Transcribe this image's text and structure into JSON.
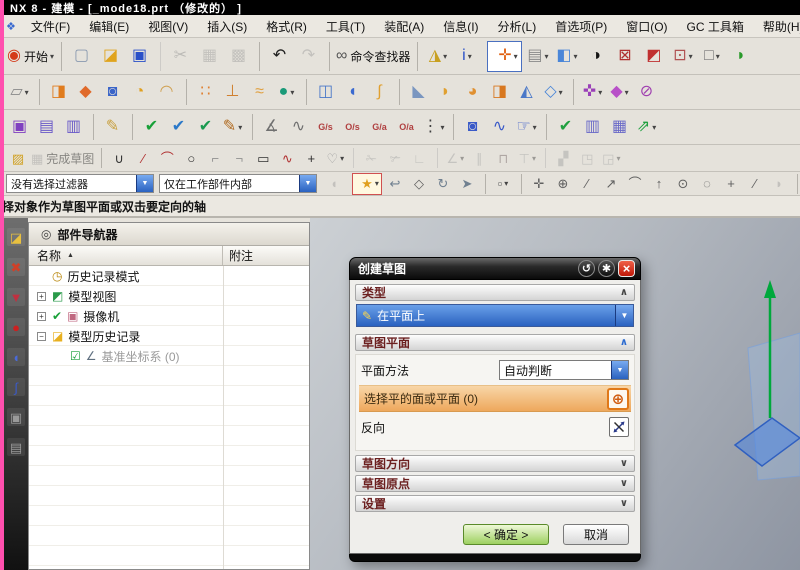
{
  "app": {
    "title": "NX 8 - 建模 - [_mode18.prt （修改的） ]"
  },
  "menu": {
    "window_icon": "❖",
    "items": [
      {
        "n": "menu-file",
        "label": "文件(F)"
      },
      {
        "n": "menu-edit",
        "label": "编辑(E)"
      },
      {
        "n": "menu-view",
        "label": "视图(V)"
      },
      {
        "n": "menu-insert",
        "label": "插入(S)"
      },
      {
        "n": "menu-format",
        "label": "格式(R)"
      },
      {
        "n": "menu-tools",
        "label": "工具(T)"
      },
      {
        "n": "menu-assemblies",
        "label": "装配(A)"
      },
      {
        "n": "menu-information",
        "label": "信息(I)"
      },
      {
        "n": "menu-analysis",
        "label": "分析(L)"
      },
      {
        "n": "menu-preferences",
        "label": "首选项(P)"
      },
      {
        "n": "menu-window",
        "label": "窗口(O)"
      },
      {
        "n": "menu-gc-toolbox",
        "label": "GC 工具箱"
      },
      {
        "n": "menu-help",
        "label": "帮助(H)"
      }
    ]
  },
  "toolbars": {
    "row_a": [
      {
        "n": "start-button",
        "g": "◉",
        "c": "#d43a1a",
        "label": "开始",
        "dd": 1
      },
      {
        "n": "new-file-button",
        "g": "▢",
        "c": "#8a9ab0",
        "sep": 1
      },
      {
        "n": "open-file-button",
        "g": "◪",
        "c": "#e0a41e"
      },
      {
        "n": "save-button",
        "g": "▣",
        "c": "#2a50c8"
      },
      {
        "n": "cut-button",
        "g": "✂",
        "c": "#8a8a8a",
        "d": 1,
        "sep": 1
      },
      {
        "n": "copy-button",
        "g": "▦",
        "c": "#9a9a9a",
        "d": 1
      },
      {
        "n": "paste-button",
        "g": "▩",
        "c": "#9a9a9a",
        "d": 1
      },
      {
        "n": "undo-button",
        "g": "↶",
        "c": "#202020",
        "sep": 1
      },
      {
        "n": "redo-button",
        "g": "↷",
        "c": "#9a9a9a",
        "d": 1
      },
      {
        "n": "command-finder-button",
        "g": "∞",
        "c": "#555555",
        "label": "命令查找器",
        "sep": 1
      },
      {
        "n": "sketch-in-task-button",
        "g": "◮",
        "c": "#c8a020",
        "dd": 1,
        "sep": 1
      },
      {
        "n": "info-button",
        "g": "i",
        "c": "#2a50c8",
        "dd": 1
      },
      {
        "n": "fit-view-button",
        "g": "✛",
        "c": "#e06010",
        "dd": 1,
        "sep": 1,
        "b": "#4a70c0",
        "bg": "#ffffff"
      },
      {
        "n": "layout-button",
        "g": "▤",
        "c": "#8a8a8a",
        "dd": 1
      },
      {
        "n": "shaded-view-button",
        "g": "◧",
        "c": "#4a86d8",
        "dd": 1
      },
      {
        "n": "render-style-button",
        "g": "◑",
        "c": "#141414"
      },
      {
        "n": "clip-section-button",
        "g": "⊠",
        "c": "#b03030"
      },
      {
        "n": "section-view-button",
        "g": "◩",
        "c": "#c03030"
      },
      {
        "n": "edit-section-button",
        "g": "⊡",
        "c": "#b05050",
        "dd": 1
      },
      {
        "n": "background-button",
        "g": "□",
        "c": "#787878",
        "dd": 1
      },
      {
        "n": "edge-display-button",
        "g": "◗",
        "c": "#2a9a2a"
      }
    ],
    "row_b": [
      {
        "n": "datum-plane-button",
        "g": "▱",
        "c": "#8a8a8a",
        "dd": 1
      },
      {
        "n": "extrude-button",
        "g": "◨",
        "c": "#e07c1e",
        "sep": 1
      },
      {
        "n": "revolve-button",
        "g": "◆",
        "c": "#e06a2a"
      },
      {
        "n": "hole-button",
        "g": "◙",
        "c": "#3a64c8"
      },
      {
        "n": "boss-button",
        "g": "◔",
        "c": "#e0a020"
      },
      {
        "n": "pocket-button",
        "g": "◠",
        "c": "#d0a050"
      },
      {
        "n": "pattern-feature-button",
        "g": "∷",
        "c": "#e08030",
        "sep": 1
      },
      {
        "n": "draft-button",
        "g": "⊥",
        "c": "#d08030"
      },
      {
        "n": "chain-feature-button",
        "g": "≈",
        "c": "#e0a040"
      },
      {
        "n": "unite-button",
        "g": "●",
        "c": "#1a9a78",
        "dd": 1
      },
      {
        "n": "trim-body-button",
        "g": "◫",
        "c": "#4a78c8",
        "sep": 1
      },
      {
        "n": "split-body-button",
        "g": "◖",
        "c": "#3a6ad0"
      },
      {
        "n": "bend-button",
        "g": "∫",
        "c": "#e0a030"
      },
      {
        "n": "chamfer-button",
        "g": "◣",
        "c": "#7a96c0",
        "sep": 1
      },
      {
        "n": "edge-blend-button",
        "g": "◗",
        "c": "#e0a030"
      },
      {
        "n": "face-blend-button",
        "g": "◕",
        "c": "#e09030"
      },
      {
        "n": "box-feature-button",
        "g": "◨",
        "c": "#d87820"
      },
      {
        "n": "taper-button",
        "g": "◭",
        "c": "#4a78c8"
      },
      {
        "n": "wireframe-cube-button",
        "g": "◇",
        "c": "#4a86d8",
        "dd": 1
      },
      {
        "n": "move-face-button",
        "g": "✜",
        "c": "#9a40b8",
        "dd": 1,
        "sep": 1
      },
      {
        "n": "offset-region-button",
        "g": "◆",
        "c": "#b850c8",
        "dd": 1
      },
      {
        "n": "delete-face-button",
        "g": "⊘",
        "c": "#a040b0"
      }
    ],
    "row_c": [
      {
        "n": "show-hide-button",
        "g": "▣",
        "c": "#8040c0"
      },
      {
        "n": "layer-settings-button",
        "g": "▤",
        "c": "#6a5ac8"
      },
      {
        "n": "layer-category-button",
        "g": "▥",
        "c": "#6a5ac8"
      },
      {
        "n": "tag-button",
        "g": "✎",
        "c": "#c8a040",
        "sep": 1
      },
      {
        "n": "examine-geometry-button",
        "g": "✔",
        "c": "#18a038",
        "sep": 1
      },
      {
        "n": "check-mate-button",
        "g": "✔",
        "c": "#2a78c8"
      },
      {
        "n": "heal-geometry-button",
        "g": "✔",
        "c": "#1a9a50"
      },
      {
        "n": "edit-text-button",
        "g": "✎",
        "c": "#b06a20",
        "dd": 1
      },
      {
        "n": "deviation-gauge-button",
        "g": "∡",
        "c": "#707070",
        "sep": 1
      },
      {
        "n": "deviation-check-button",
        "g": "∿",
        "c": "#707070"
      },
      {
        "n": "gs-analysis-button",
        "g": "G/s",
        "c": "#b04040"
      },
      {
        "n": "os-analysis-button",
        "g": "O/s",
        "c": "#b04040"
      },
      {
        "n": "ga-analysis-button",
        "g": "G/a",
        "c": "#b04040"
      },
      {
        "n": "oa-analysis-button",
        "g": "O/a",
        "c": "#b04040"
      },
      {
        "n": "list-options-button",
        "g": "⋮",
        "c": "#404040",
        "dd": 1
      },
      {
        "n": "part-cylinder-button",
        "g": "◙",
        "c": "#3a5ac8",
        "sep": 1
      },
      {
        "n": "spring-tool-button",
        "g": "∿",
        "c": "#3a5ac8"
      },
      {
        "n": "grip-tool-button",
        "g": "☞",
        "c": "#3a5ac8",
        "dd": 1
      },
      {
        "n": "validate-button",
        "g": "✔",
        "c": "#20a040",
        "sep": 1
      },
      {
        "n": "requirements-button",
        "g": "▥",
        "c": "#6a6ac8"
      },
      {
        "n": "spreadsheet-button",
        "g": "▦",
        "c": "#6a6ac8"
      },
      {
        "n": "vector-check-button",
        "g": "⇗",
        "c": "#20a040",
        "dd": 1
      }
    ],
    "row_d": [
      {
        "n": "sketch-button",
        "g": "▨",
        "c": "#d0a020"
      },
      {
        "n": "finish-sketch-button",
        "g": "▦",
        "c": "#9a9a9a",
        "label": "完成草图",
        "d": 1
      },
      {
        "n": "profile-button",
        "g": "∪",
        "c": "#303030",
        "sep": 1
      },
      {
        "n": "line-button",
        "g": "∕",
        "c": "#b03030"
      },
      {
        "n": "arc-button",
        "g": "⌒",
        "c": "#b03030"
      },
      {
        "n": "circle-button",
        "g": "○",
        "c": "#303030"
      },
      {
        "n": "fillet-button",
        "g": "⌐",
        "c": "#909090"
      },
      {
        "n": "sketch-chamfer-button",
        "g": "¬",
        "c": "#909090"
      },
      {
        "n": "rectangle-button",
        "g": "▭",
        "c": "#303030"
      },
      {
        "n": "studio-spline-button",
        "g": "∿",
        "c": "#b03030"
      },
      {
        "n": "point-button",
        "g": "+",
        "c": "#303030"
      },
      {
        "n": "offset-curve-button",
        "g": "♡",
        "c": "#a0a0a0",
        "dd": 1
      },
      {
        "n": "quick-trim-button",
        "g": "✁",
        "c": "#a0a0a0",
        "d": 1,
        "sep": 1
      },
      {
        "n": "quick-extend-button",
        "g": "✃",
        "c": "#a0a0a0",
        "d": 1
      },
      {
        "n": "make-corner-button",
        "g": "∟",
        "c": "#a0a0a0",
        "d": 1
      },
      {
        "n": "constraints-button",
        "g": "∠",
        "c": "#a0a0a0",
        "d": 1,
        "dd": 1,
        "sep": 1
      },
      {
        "n": "parallel-constraint-button",
        "g": "∥",
        "c": "#a0a0a0",
        "d": 1
      },
      {
        "n": "dimension-button",
        "g": "⊓",
        "c": "#b05050",
        "d": 1
      },
      {
        "n": "auto-dimension-button",
        "g": "⊤",
        "c": "#a0a0a0",
        "d": 1,
        "dd": 1
      },
      {
        "n": "pattern-curve-button",
        "g": "▞",
        "c": "#a0a0a0",
        "d": 1,
        "sep": 1
      },
      {
        "n": "mirror-curve-button",
        "g": "◳",
        "c": "#a0a0a0",
        "d": 1
      },
      {
        "n": "intersection-point-button",
        "g": "◲",
        "c": "#a0a0a0",
        "d": 1,
        "dd": 1
      }
    ],
    "row_e_icons": [
      {
        "n": "listen-button",
        "g": "◖",
        "c": "#9a9a9a",
        "d": 1
      },
      {
        "n": "snap-point-toggle",
        "g": "★",
        "c": "#e0a020",
        "dd": 1,
        "sep": 1,
        "b": "#d05050",
        "bg": "#fff8e0"
      },
      {
        "n": "rollback-button",
        "g": "↩",
        "c": "#708090"
      },
      {
        "n": "show-solid-button",
        "g": "◇",
        "c": "#606060"
      },
      {
        "n": "rotate-view-button",
        "g": "↻",
        "c": "#708090"
      },
      {
        "n": "pan-button",
        "g": "➤",
        "c": "#708090"
      },
      {
        "n": "marquee-select-button",
        "g": "▫",
        "c": "#606060",
        "dd": 1,
        "sep": 1
      },
      {
        "n": "snap-move-button",
        "g": "✛",
        "c": "#606060",
        "sep": 1
      },
      {
        "n": "snap-rotate-button",
        "g": "⊕",
        "c": "#606060"
      },
      {
        "n": "snap-line-button",
        "g": "∕",
        "c": "#606060"
      },
      {
        "n": "snap-endpoint-button",
        "g": "↗",
        "c": "#606060"
      },
      {
        "n": "snap-curve-button",
        "g": "⌒",
        "c": "#606060"
      },
      {
        "n": "snap-vertical-button",
        "g": "↑",
        "c": "#606060"
      },
      {
        "n": "snap-center-button",
        "g": "⊙",
        "c": "#606060"
      },
      {
        "n": "snap-quadrant-button",
        "g": "◌",
        "c": "#606060"
      },
      {
        "n": "snap-point-button",
        "g": "+",
        "c": "#606060"
      },
      {
        "n": "snap-intersection-button",
        "g": "∕",
        "c": "#606060"
      },
      {
        "n": "snap-face-button",
        "g": "◗",
        "c": "#9a9a9a",
        "d": 1
      },
      {
        "n": "work-part-cube-button",
        "g": "◧",
        "c": "#4a86d8",
        "sep": 1
      }
    ]
  },
  "selection_bar": {
    "filter_value": "没有选择过滤器",
    "scope_value": "仅在工作部件内部"
  },
  "prompt": {
    "text": "择对象作为草图平面或双击要定向的轴"
  },
  "dock": {
    "icons": [
      {
        "n": "dock-roles-icon",
        "g": "◪",
        "c": "#e8c040"
      },
      {
        "n": "dock-constraint-icon",
        "g": "✖",
        "c": "#d04028"
      },
      {
        "n": "dock-datum-icon",
        "g": "▼",
        "c": "#c03040"
      },
      {
        "n": "dock-point-icon",
        "g": "●",
        "c": "#cc2020"
      },
      {
        "n": "dock-curve-icon",
        "g": "◖",
        "c": "#4a6ad8"
      },
      {
        "n": "dock-spline-icon",
        "g": "∫",
        "c": "#3a5ac8"
      },
      {
        "n": "dock-panel-icon",
        "g": "▣",
        "c": "#9a9a9a"
      },
      {
        "n": "dock-panel2-icon",
        "g": "▤",
        "c": "#9a9a9a"
      }
    ]
  },
  "navigator": {
    "title": "部件导航器",
    "header_icon": "◎",
    "columns": {
      "name": "名称",
      "note": "附注"
    },
    "sort_indicator": "▲",
    "rows": [
      {
        "n": "tree-row-history-mode",
        "exp": "",
        "icons": [
          {
            "g": "◷",
            "c": "#b8860b"
          }
        ],
        "label": "历史记录模式"
      },
      {
        "n": "tree-row-model-views",
        "exp": "+",
        "icons": [
          {
            "g": "◩",
            "c": "#2a9a4a"
          }
        ],
        "label": "模型视图"
      },
      {
        "n": "tree-row-cameras",
        "exp": "+",
        "icons": [
          {
            "g": "✔",
            "c": "#18a038"
          },
          {
            "g": "▣",
            "c": "#c06880"
          }
        ],
        "label": "摄像机"
      },
      {
        "n": "tree-row-model-history",
        "exp": "−",
        "icons": [
          {
            "g": "◪",
            "c": "#e8b020"
          }
        ],
        "label": "模型历史记录"
      },
      {
        "n": "tree-row-datum-csys",
        "exp": "",
        "ind": 1,
        "icons": [
          {
            "g": "☑",
            "c": "#18a038"
          },
          {
            "g": "∠",
            "c": "#607080"
          }
        ],
        "label": "基准坐标系 (0)",
        "dim": 1
      }
    ]
  },
  "dialog": {
    "title": "创建草图",
    "titlebar_icons": {
      "reset": "↺",
      "settings": "✱",
      "close": "×"
    },
    "sections": {
      "type": "类型",
      "plane": "草图平面",
      "orientation": "草图方向",
      "origin": "草图原点",
      "settings": "设置"
    },
    "chevron_up": "∧",
    "chevron_down": "∨",
    "type_icon": "✎",
    "type_value": "在平面上",
    "plane_method_label": "平面方法",
    "plane_method_value": "自动判断",
    "select_text": "选择平的面或平面 (0)",
    "select_icon": "⊕",
    "reverse_label": "反向",
    "ok_label": "< 确定 >",
    "cancel_label": "取消"
  },
  "colors": {
    "titlebar": "#000000",
    "magenta_strip": "#ff4fae",
    "type_selected_blue": "#2a62c0",
    "select_row_orange": "#eea85c",
    "ok_green": "#9ed060",
    "axis_green": "#00a83c",
    "plane_blue": "#3060c0"
  }
}
